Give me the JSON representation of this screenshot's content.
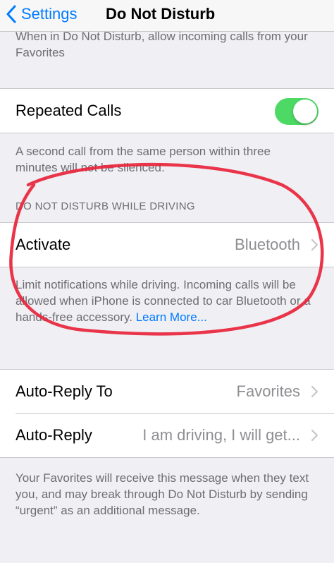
{
  "nav": {
    "back_label": "Settings",
    "title": "Do Not Disturb"
  },
  "favorites_footer": "When in Do Not Disturb, allow incoming calls from your Favorites",
  "repeated_calls": {
    "label": "Repeated Calls",
    "enabled": true,
    "footer": "A second call from the same person within three minutes will not be silenced."
  },
  "driving_section": {
    "header": "DO NOT DISTURB WHILE DRIVING",
    "activate_label": "Activate",
    "activate_value": "Bluetooth",
    "footer": "Limit notifications while driving. Incoming calls will be allowed when iPhone is connected to car Bluetooth or a hands-free accessory.",
    "learn_more": "Learn More..."
  },
  "auto_reply": {
    "to_label": "Auto-Reply To",
    "to_value": "Favorites",
    "reply_label": "Auto-Reply",
    "reply_value": "I am driving, I will get...",
    "footer": "Your Favorites will receive this message when they text you, and may break through Do Not Disturb by sending “urgent” as an additional message."
  },
  "colors": {
    "accent": "#007aff",
    "toggle_on": "#4cd964",
    "annotation": "#e8243a"
  },
  "icons": {
    "back": "chevron-left-icon",
    "disclosure": "chevron-right-icon"
  }
}
